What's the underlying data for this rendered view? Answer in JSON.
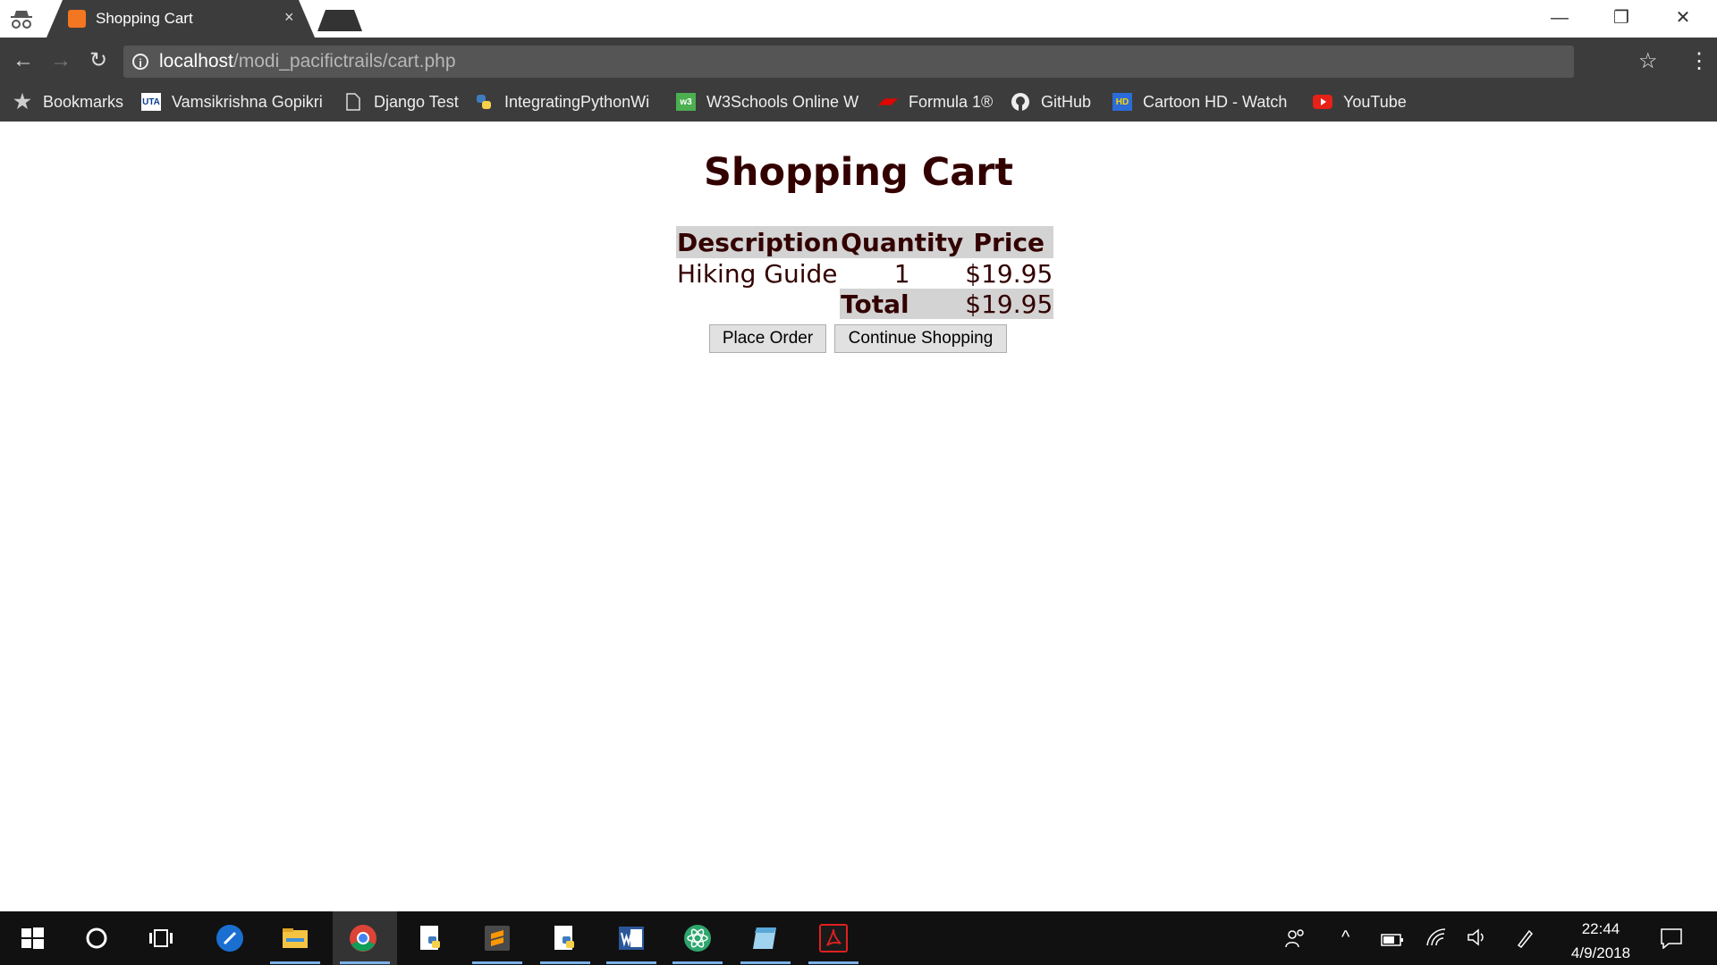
{
  "browser": {
    "tab_title": "Shopping Cart",
    "tab_close": "×",
    "url_host": "localhost",
    "url_path": "/modi_pacifictrails/cart.php",
    "window_minimize": "—",
    "window_restore": "❐",
    "window_close": "✕",
    "nav_back": "←",
    "nav_forward": "→",
    "nav_reload": "↻",
    "info": "i",
    "star": "☆",
    "menu": "⋮"
  },
  "bookmarks": [
    {
      "label": "Bookmarks",
      "icon": "star-icon"
    },
    {
      "label": "Vamsikrishna Gopikri",
      "icon": "uta-icon"
    },
    {
      "label": "Django Test",
      "icon": "page-icon"
    },
    {
      "label": "IntegratingPythonWi",
      "icon": "python-icon"
    },
    {
      "label": "W3Schools Online W",
      "icon": "w3schools-icon"
    },
    {
      "label": "Formula 1®",
      "icon": "f1-icon"
    },
    {
      "label": "GitHub",
      "icon": "github-icon"
    },
    {
      "label": "Cartoon HD - Watch",
      "icon": "cartoon-hd-icon"
    },
    {
      "label": "YouTube",
      "icon": "youtube-icon"
    }
  ],
  "page": {
    "title": "Shopping Cart",
    "table": {
      "headers": [
        "Description",
        "Quantity",
        "Price"
      ],
      "rows": [
        {
          "description": "Hiking Guide",
          "quantity": "1",
          "price": "$19.95"
        }
      ],
      "total_label": "Total",
      "total_value": "$19.95"
    },
    "buttons": {
      "place_order": "Place Order",
      "continue_shopping": "Continue Shopping"
    }
  },
  "taskbar": {
    "time": "22:44",
    "date": "4/9/2018",
    "apps": [
      "windows-start-icon",
      "cortana-icon",
      "task-view-icon",
      "app-icon",
      "file-explorer-icon",
      "chrome-icon",
      "python-editor-icon",
      "sublime-text-icon",
      "python-icon",
      "word-icon",
      "atom-icon",
      "notepad-icon",
      "acrobat-icon"
    ]
  },
  "colors": {
    "page_heading": "#330000",
    "table_header_bg": "#d3d3d3",
    "chrome_dark": "#3c3c3c"
  }
}
